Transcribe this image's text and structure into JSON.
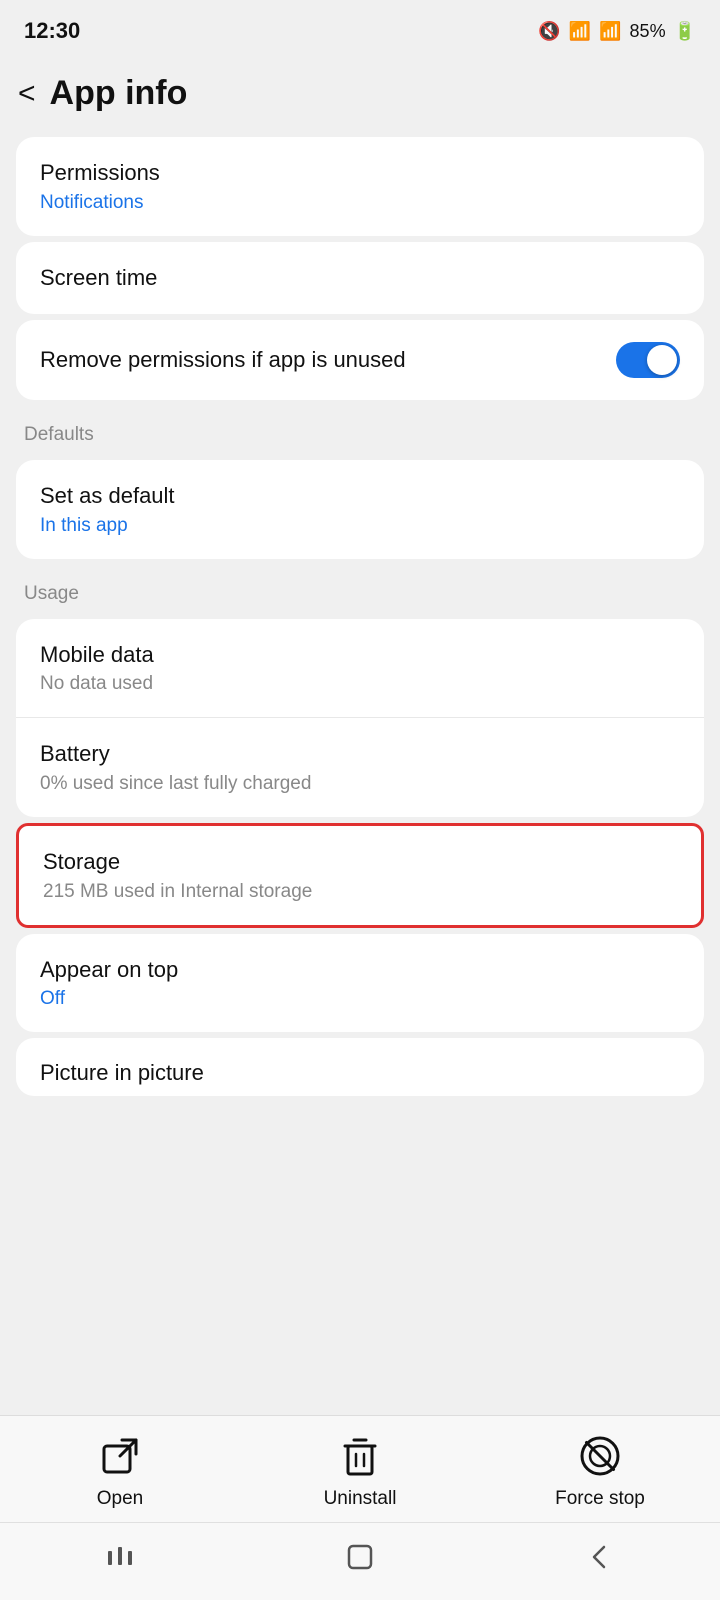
{
  "statusBar": {
    "time": "12:30",
    "battery": "85%"
  },
  "header": {
    "backLabel": "<",
    "title": "App info"
  },
  "sections": {
    "permissions": {
      "title": "Permissions",
      "subtitle": "Notifications"
    },
    "screenTime": {
      "title": "Screen time"
    },
    "removePermissions": {
      "title": "Remove permissions if app is unused",
      "toggleOn": true
    },
    "defaultsLabel": "Defaults",
    "setAsDefault": {
      "title": "Set as default",
      "subtitle": "In this app"
    },
    "usageLabel": "Usage",
    "mobileData": {
      "title": "Mobile data",
      "subtitle": "No data used"
    },
    "battery": {
      "title": "Battery",
      "subtitle": "0% used since last fully charged"
    },
    "storage": {
      "title": "Storage",
      "subtitle": "215 MB used in Internal storage"
    },
    "appearOnTop": {
      "title": "Appear on top",
      "subtitle": "Off"
    },
    "pictureInPicture": {
      "title": "Picture in picture"
    }
  },
  "bottomActions": [
    {
      "id": "open",
      "label": "Open"
    },
    {
      "id": "uninstall",
      "label": "Uninstall"
    },
    {
      "id": "force-stop",
      "label": "Force stop"
    }
  ],
  "systemNav": {
    "recent": "|||",
    "home": "☐",
    "back": "<"
  }
}
